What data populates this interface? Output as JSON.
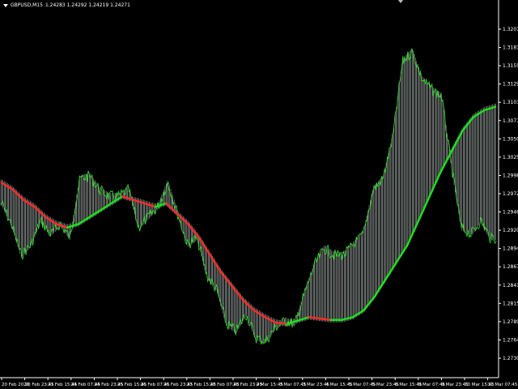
{
  "title": {
    "symbol_timeframe": "GBPUSD,M15",
    "ohlc": "1.24283 1.24292 1.24219 1.24271",
    "menu_icon": "triangle-down-icon"
  },
  "colors": {
    "background": "#000000",
    "price": "#2fe02f",
    "mesh": "#e6efe9",
    "mesh_dark": "#9aa59e",
    "ma_up": "#19e319",
    "ma_down": "#ff2a2a",
    "axis": "#ffffff"
  },
  "chart_data": {
    "type": "line",
    "title": "",
    "xlabel": "",
    "ylabel": "",
    "ylim": [
      1.27305,
      1.32075
    ],
    "price_axis_ticks": [
      "1.32075",
      "1.31815",
      "1.31555",
      "1.31290",
      "1.31030",
      "1.30770",
      "1.30505",
      "1.30250",
      "1.29985",
      "1.29725",
      "1.29460",
      "1.29200",
      "1.28940",
      "1.28675",
      "1.28415",
      "1.28155",
      "1.27895",
      "1.27640",
      "1.27305"
    ],
    "time_axis_ticks": [
      "20 Feb 2020",
      "20 Feb 23:45",
      "21 Feb 15:45",
      "24 Feb 07:45",
      "24 Feb 23:45",
      "25 Feb 15:45",
      "26 Feb 07:45",
      "26 Feb 23:45",
      "27 Feb 15:45",
      "28 Feb 07:45",
      "28 Feb 23:45",
      "2 Mar 15:45",
      "3 Mar 07:45",
      "3 Mar 23:45",
      "4 Mar 15:45",
      "5 Mar 07:45",
      "5 Mar 23:45",
      "6 Mar 15:45",
      "9 Mar 07:45",
      "9 Mar 23:45",
      "10 Mar 15:45",
      "11 Mar 07:45"
    ],
    "series": [
      {
        "values": [
          1.2955,
          1.2925,
          1.288,
          1.2895,
          1.293,
          1.291,
          1.2925,
          1.2905,
          1.299,
          1.2995,
          1.2975,
          1.2965,
          1.2965,
          1.2975,
          1.292,
          1.2935,
          1.295,
          1.2985,
          1.294,
          1.2895,
          1.2905,
          1.285,
          1.283,
          1.278,
          1.277,
          1.2795,
          1.276,
          1.2755,
          1.2775,
          1.2785,
          1.278,
          1.2825,
          1.2865,
          1.289,
          1.288,
          1.288,
          1.2895,
          1.291,
          1.2975,
          1.299,
          1.305,
          1.316,
          1.3175,
          1.3135,
          1.312,
          1.311,
          1.301,
          1.292,
          1.291,
          1.293,
          1.2905
        ]
      },
      {
        "values": [
          1.2985,
          1.2975,
          1.296,
          1.295,
          1.2935,
          1.2925,
          1.292,
          1.2925,
          1.2935,
          1.2945,
          1.2955,
          1.2965,
          1.296,
          1.2955,
          1.295,
          1.2955,
          1.294,
          1.2925,
          1.2905,
          1.288,
          1.2855,
          1.2835,
          1.2815,
          1.28,
          1.279,
          1.2782,
          1.278,
          1.2785,
          1.279,
          1.2788,
          1.2786,
          1.2786,
          1.279,
          1.28,
          1.282,
          1.2845,
          1.287,
          1.2895,
          1.293,
          1.2965,
          1.3,
          1.303,
          1.306,
          1.308,
          1.309,
          1.3095
        ]
      }
    ]
  }
}
